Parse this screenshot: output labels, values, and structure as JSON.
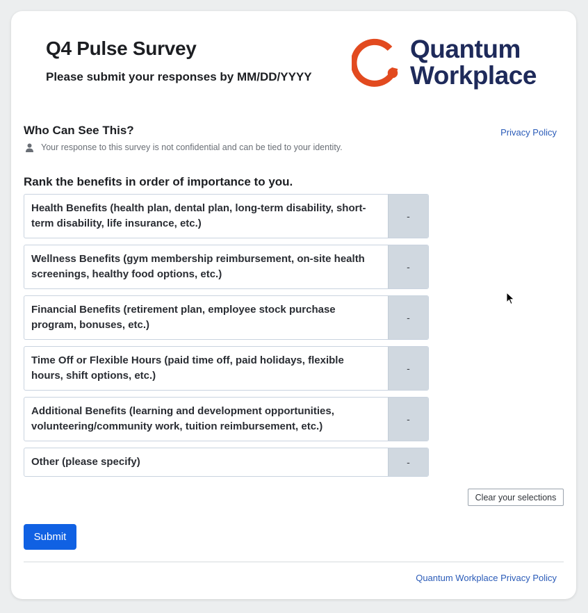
{
  "header": {
    "title": "Q4 Pulse Survey",
    "subtitle": "Please submit your responses by MM/DD/YYYY"
  },
  "logo": {
    "line1": "Quantum",
    "line2": "Workplace",
    "mark_color": "#e24a1f",
    "text_color": "#1e2a5a"
  },
  "visibility": {
    "heading": "Who Can See This?",
    "privacy_link": "Privacy Policy",
    "icon": "person-icon",
    "notice": "Your response to this survey is not confidential and can be tied to your identity."
  },
  "question": {
    "text": "Rank the benefits in order of importance to you.",
    "items": [
      {
        "label": "Health Benefits (health plan, dental plan, long-term disability, short-term disability, life insurance, etc.)",
        "rank": "-"
      },
      {
        "label": "Wellness Benefits (gym membership reimbursement, on-site health screenings, healthy food options, etc.)",
        "rank": "-"
      },
      {
        "label": "Financial Benefits (retirement plan, employee stock purchase program, bonuses, etc.)",
        "rank": "-"
      },
      {
        "label": "Time Off or Flexible Hours (paid time off, paid holidays, flexible hours, shift options, etc.)",
        "rank": "-"
      },
      {
        "label": "Additional Benefits (learning and development opportunities, volunteering/community work, tuition reimbursement, etc.)",
        "rank": "-"
      },
      {
        "label": "Other (please specify)",
        "rank": "-"
      }
    ],
    "clear_label": "Clear your selections"
  },
  "actions": {
    "submit_label": "Submit",
    "accent_color": "#1061e3"
  },
  "footer": {
    "link": "Quantum Workplace Privacy Policy"
  }
}
